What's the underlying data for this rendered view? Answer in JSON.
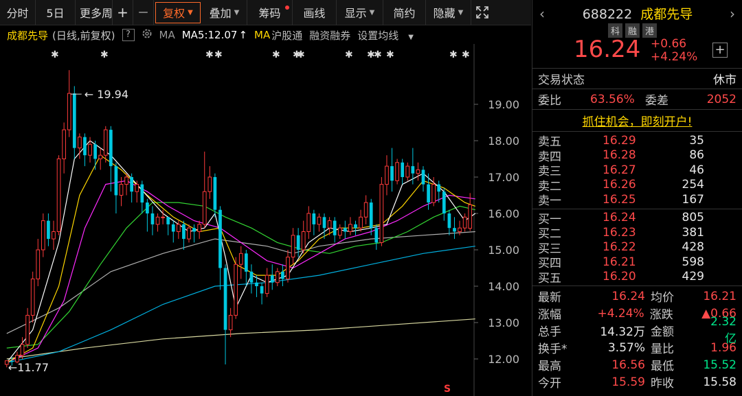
{
  "toolbar": {
    "items": [
      "分时",
      "5日",
      "更多周",
      "+",
      "—",
      "复权",
      "叠加",
      "筹码",
      "画线",
      "显示",
      "简约",
      "隐藏"
    ],
    "expand_icon": "expand-icon"
  },
  "chart_header": {
    "name": "成都先导",
    "mode": "(日线,前复权)",
    "help": "?",
    "ma_label": "MA",
    "ma5": "MA5:12.07",
    "ma_arrow": "↑",
    "ma2": "MA",
    "hgt": "沪股通",
    "rzrq": "融资融券",
    "set_ma": "设置均线"
  },
  "colors": {
    "up": "#ff3b3b",
    "down": "#00c8e0",
    "ma5": "#ffffff",
    "ma10": "#ffd700",
    "ma20": "#ff2aff",
    "ma30": "#33d633",
    "ma60": "#b0b0b0",
    "ma120": "#00b0e0",
    "ma250": "#d8d8a0"
  },
  "chart_data": {
    "type": "candlestick",
    "y_ticks": [
      "19.00",
      "18.00",
      "17.00",
      "16.00",
      "15.00",
      "14.00",
      "13.00",
      "12.00"
    ],
    "ylim": [
      11.5,
      20.5
    ],
    "high_label": "19.94",
    "low_label": "11.77",
    "candles": [
      [
        11.85,
        11.95,
        11.77,
        11.95
      ],
      [
        11.95,
        11.92,
        11.82,
        12.05
      ],
      [
        11.92,
        12.1,
        11.88,
        12.2
      ],
      [
        12.1,
        12.4,
        12.0,
        12.6
      ],
      [
        12.4,
        13.2,
        12.3,
        13.4
      ],
      [
        13.2,
        14.2,
        13.0,
        14.4
      ],
      [
        14.2,
        15.0,
        14.0,
        15.3
      ],
      [
        15.0,
        15.8,
        14.8,
        16.0
      ],
      [
        15.8,
        15.3,
        15.1,
        16.0
      ],
      [
        15.3,
        15.5,
        15.0,
        15.8
      ],
      [
        15.5,
        17.5,
        15.4,
        17.6
      ],
      [
        17.5,
        18.3,
        17.1,
        18.5
      ],
      [
        18.3,
        19.3,
        18.1,
        19.94
      ],
      [
        19.3,
        17.8,
        17.5,
        19.5
      ],
      [
        17.8,
        18.1,
        17.5,
        18.2
      ],
      [
        18.1,
        17.6,
        17.3,
        18.2
      ],
      [
        17.6,
        17.9,
        17.4,
        18.1
      ],
      [
        17.9,
        17.5,
        17.2,
        18.0
      ],
      [
        17.5,
        17.6,
        17.2,
        17.8
      ],
      [
        17.6,
        18.3,
        17.4,
        18.4
      ],
      [
        18.3,
        17.3,
        16.6,
        18.4
      ],
      [
        17.3,
        16.5,
        16.0,
        17.4
      ],
      [
        16.5,
        16.8,
        16.2,
        17.0
      ],
      [
        16.8,
        17.0,
        16.5,
        17.1
      ],
      [
        17.0,
        16.6,
        16.3,
        17.1
      ],
      [
        16.6,
        16.8,
        16.3,
        16.9
      ],
      [
        16.8,
        16.3,
        16.0,
        16.9
      ],
      [
        16.3,
        16.0,
        15.5,
        16.4
      ],
      [
        16.0,
        15.7,
        15.4,
        16.2
      ],
      [
        15.7,
        15.9,
        15.5,
        16.0
      ],
      [
        15.9,
        15.9,
        15.7,
        16.1
      ],
      [
        15.9,
        15.7,
        15.4,
        15.9
      ],
      [
        15.7,
        15.5,
        15.2,
        15.8
      ],
      [
        15.5,
        15.7,
        15.3,
        15.8
      ],
      [
        15.7,
        15.3,
        15.0,
        15.8
      ],
      [
        15.3,
        15.6,
        15.2,
        15.7
      ],
      [
        15.6,
        15.5,
        15.2,
        15.7
      ],
      [
        15.5,
        15.7,
        15.3,
        15.8
      ],
      [
        15.7,
        16.6,
        15.6,
        17.7
      ],
      [
        16.6,
        17.0,
        16.4,
        17.3
      ],
      [
        17.0,
        16.1,
        15.9,
        17.1
      ],
      [
        16.1,
        14.5,
        13.9,
        16.2
      ],
      [
        14.5,
        12.8,
        11.85,
        14.6
      ],
      [
        12.8,
        13.2,
        12.6,
        13.4
      ],
      [
        13.2,
        14.6,
        13.1,
        14.8
      ],
      [
        14.6,
        14.9,
        14.2,
        15.1
      ],
      [
        14.9,
        14.4,
        14.0,
        15.0
      ],
      [
        14.4,
        14.1,
        13.8,
        14.6
      ],
      [
        14.1,
        14.0,
        13.7,
        14.3
      ],
      [
        14.0,
        13.8,
        13.5,
        14.1
      ],
      [
        13.8,
        14.3,
        13.7,
        14.5
      ],
      [
        14.3,
        14.1,
        13.9,
        14.6
      ],
      [
        14.1,
        14.4,
        14.0,
        14.5
      ],
      [
        14.4,
        14.2,
        14.0,
        14.6
      ],
      [
        14.2,
        14.8,
        14.1,
        15.0
      ],
      [
        14.8,
        15.4,
        14.6,
        15.6
      ],
      [
        15.4,
        15.0,
        14.8,
        15.6
      ],
      [
        15.0,
        15.5,
        14.9,
        15.8
      ],
      [
        15.5,
        16.0,
        15.3,
        16.2
      ],
      [
        16.0,
        15.7,
        15.4,
        16.1
      ],
      [
        15.7,
        15.9,
        15.5,
        16.0
      ],
      [
        15.9,
        15.6,
        15.3,
        16.0
      ],
      [
        15.6,
        15.8,
        15.4,
        15.9
      ],
      [
        15.8,
        15.4,
        15.2,
        15.9
      ],
      [
        15.4,
        15.6,
        15.3,
        15.7
      ],
      [
        15.6,
        15.5,
        15.3,
        15.8
      ],
      [
        15.5,
        15.7,
        15.4,
        15.9
      ],
      [
        15.7,
        15.6,
        15.4,
        15.8
      ],
      [
        15.6,
        15.9,
        15.5,
        16.1
      ],
      [
        15.9,
        16.3,
        15.7,
        16.5
      ],
      [
        16.3,
        15.6,
        15.4,
        16.4
      ],
      [
        15.6,
        15.2,
        15.0,
        15.7
      ],
      [
        15.2,
        16.8,
        15.1,
        17.0
      ],
      [
        16.8,
        17.3,
        16.5,
        17.6
      ],
      [
        17.3,
        16.9,
        16.6,
        17.8
      ],
      [
        16.9,
        17.4,
        16.8,
        17.5
      ],
      [
        17.4,
        17.0,
        16.8,
        17.5
      ],
      [
        17.0,
        17.3,
        16.9,
        17.4
      ],
      [
        17.3,
        17.1,
        16.8,
        17.8
      ],
      [
        17.1,
        17.2,
        16.9,
        17.4
      ],
      [
        17.2,
        16.8,
        16.6,
        17.3
      ],
      [
        16.8,
        16.3,
        16.1,
        17.1
      ],
      [
        16.3,
        16.8,
        16.2,
        17.0
      ],
      [
        16.8,
        16.6,
        16.3,
        16.9
      ],
      [
        16.6,
        16.0,
        15.8,
        16.7
      ],
      [
        16.0,
        15.6,
        15.4,
        16.1
      ],
      [
        15.6,
        15.5,
        15.3,
        15.9
      ],
      [
        15.5,
        15.6,
        15.4,
        15.8
      ],
      [
        15.6,
        15.9,
        15.5,
        16.0
      ],
      [
        15.59,
        16.24,
        15.52,
        16.56
      ]
    ],
    "ma_lines": {
      "ma5": [
        [
          0,
          11.9
        ],
        [
          5,
          12.8
        ],
        [
          10,
          15.2
        ],
        [
          13,
          17.5
        ],
        [
          16,
          18.0
        ],
        [
          20,
          17.6
        ],
        [
          25,
          16.8
        ],
        [
          30,
          16.0
        ],
        [
          35,
          15.5
        ],
        [
          38,
          15.6
        ],
        [
          40,
          16.0
        ],
        [
          42,
          14.8
        ],
        [
          44,
          13.4
        ],
        [
          47,
          14.3
        ],
        [
          50,
          14.1
        ],
        [
          54,
          14.3
        ],
        [
          58,
          15.2
        ],
        [
          62,
          15.6
        ],
        [
          66,
          15.5
        ],
        [
          70,
          15.6
        ],
        [
          73,
          15.7
        ],
        [
          76,
          16.8
        ],
        [
          80,
          17.1
        ],
        [
          84,
          16.6
        ],
        [
          88,
          15.8
        ],
        [
          90,
          16.0
        ]
      ],
      "ma10": [
        [
          0,
          11.9
        ],
        [
          5,
          12.3
        ],
        [
          10,
          14.0
        ],
        [
          14,
          16.5
        ],
        [
          18,
          17.6
        ],
        [
          22,
          17.2
        ],
        [
          27,
          16.5
        ],
        [
          32,
          15.9
        ],
        [
          37,
          15.5
        ],
        [
          41,
          15.6
        ],
        [
          44,
          14.6
        ],
        [
          48,
          14.3
        ],
        [
          52,
          14.3
        ],
        [
          56,
          14.7
        ],
        [
          60,
          15.3
        ],
        [
          64,
          15.6
        ],
        [
          68,
          15.6
        ],
        [
          72,
          15.7
        ],
        [
          76,
          16.2
        ],
        [
          80,
          16.9
        ],
        [
          84,
          16.7
        ],
        [
          88,
          16.3
        ],
        [
          90,
          16.2
        ]
      ],
      "ma20": [
        [
          0,
          11.9
        ],
        [
          6,
          12.3
        ],
        [
          11,
          13.6
        ],
        [
          15,
          15.6
        ],
        [
          19,
          16.8
        ],
        [
          23,
          16.9
        ],
        [
          27,
          16.6
        ],
        [
          31,
          16.2
        ],
        [
          36,
          15.8
        ],
        [
          41,
          15.6
        ],
        [
          45,
          15.2
        ],
        [
          50,
          14.7
        ],
        [
          55,
          14.5
        ],
        [
          60,
          14.9
        ],
        [
          65,
          15.3
        ],
        [
          70,
          15.5
        ],
        [
          75,
          15.8
        ],
        [
          80,
          16.2
        ],
        [
          85,
          16.5
        ],
        [
          90,
          16.4
        ]
      ],
      "ma30": [
        [
          0,
          12.3
        ],
        [
          6,
          12.4
        ],
        [
          12,
          13.3
        ],
        [
          18,
          14.6
        ],
        [
          23,
          15.6
        ],
        [
          28,
          16.3
        ],
        [
          33,
          16.3
        ],
        [
          38,
          16.2
        ],
        [
          42,
          15.9
        ],
        [
          47,
          15.6
        ],
        [
          52,
          15.2
        ],
        [
          57,
          15.0
        ],
        [
          62,
          14.9
        ],
        [
          67,
          15.1
        ],
        [
          72,
          15.2
        ],
        [
          77,
          15.5
        ],
        [
          82,
          15.9
        ],
        [
          87,
          16.2
        ],
        [
          90,
          16.1
        ]
      ],
      "ma60": [
        [
          0,
          12.7
        ],
        [
          10,
          13.4
        ],
        [
          20,
          14.4
        ],
        [
          30,
          14.9
        ],
        [
          40,
          15.3
        ],
        [
          50,
          15.1
        ],
        [
          55,
          14.9
        ],
        [
          60,
          15.1
        ],
        [
          70,
          15.3
        ],
        [
          80,
          15.4
        ],
        [
          90,
          15.5
        ]
      ],
      "ma120": [
        [
          0,
          11.9
        ],
        [
          10,
          12.2
        ],
        [
          20,
          12.8
        ],
        [
          30,
          13.5
        ],
        [
          40,
          14.0
        ],
        [
          50,
          14.1
        ],
        [
          60,
          14.3
        ],
        [
          70,
          14.6
        ],
        [
          80,
          14.9
        ],
        [
          90,
          15.1
        ]
      ],
      "ma250": [
        [
          0,
          12.0
        ],
        [
          15,
          12.3
        ],
        [
          30,
          12.55
        ],
        [
          45,
          12.7
        ],
        [
          60,
          12.8
        ],
        [
          75,
          12.95
        ],
        [
          90,
          13.1
        ]
      ]
    }
  },
  "panel": {
    "code": "688222",
    "name": "成都先导",
    "tags": [
      "科",
      "融",
      "港"
    ],
    "price": "16.24",
    "change": "+0.66",
    "change_pct": "+4.24%",
    "add": "+",
    "status_label": "交易状态",
    "status_value": "休市",
    "weibi_label": "委比",
    "weibi_value": "63.56%",
    "weicha_label": "委差",
    "weicha_value": "2052",
    "promo": "抓住机会，即刻开户!",
    "asks": [
      {
        "label": "卖五",
        "price": "16.29",
        "vol": "35"
      },
      {
        "label": "卖四",
        "price": "16.28",
        "vol": "86"
      },
      {
        "label": "卖三",
        "price": "16.27",
        "vol": "46"
      },
      {
        "label": "卖二",
        "price": "16.26",
        "vol": "254"
      },
      {
        "label": "卖一",
        "price": "16.25",
        "vol": "167"
      }
    ],
    "bids": [
      {
        "label": "买一",
        "price": "16.24",
        "vol": "805"
      },
      {
        "label": "买二",
        "price": "16.23",
        "vol": "381"
      },
      {
        "label": "买三",
        "price": "16.22",
        "vol": "428"
      },
      {
        "label": "买四",
        "price": "16.21",
        "vol": "598"
      },
      {
        "label": "买五",
        "price": "16.20",
        "vol": "429"
      }
    ],
    "stats": [
      {
        "l1": "最新",
        "v1": "16.24",
        "c1": "red",
        "l2": "均价",
        "v2": "16.21",
        "c2": "red"
      },
      {
        "l1": "涨幅",
        "v1": "+4.24%",
        "c1": "red",
        "l2": "涨跌",
        "v2": "▲0.66",
        "c2": "red"
      },
      {
        "l1": "总手",
        "v1": "14.32万",
        "c1": "white",
        "l2": "金额",
        "v2": "2.32亿",
        "c2": "green"
      },
      {
        "l1": "换手*",
        "v1": "3.57%",
        "c1": "white",
        "l2": "量比",
        "v2": "1.96",
        "c2": "red"
      },
      {
        "l1": "最高",
        "v1": "16.56",
        "c1": "red",
        "l2": "最低",
        "v2": "15.52",
        "c2": "green"
      },
      {
        "l1": "今开",
        "v1": "15.59",
        "c1": "red",
        "l2": "昨收",
        "v2": "15.58",
        "c2": "white"
      }
    ]
  }
}
